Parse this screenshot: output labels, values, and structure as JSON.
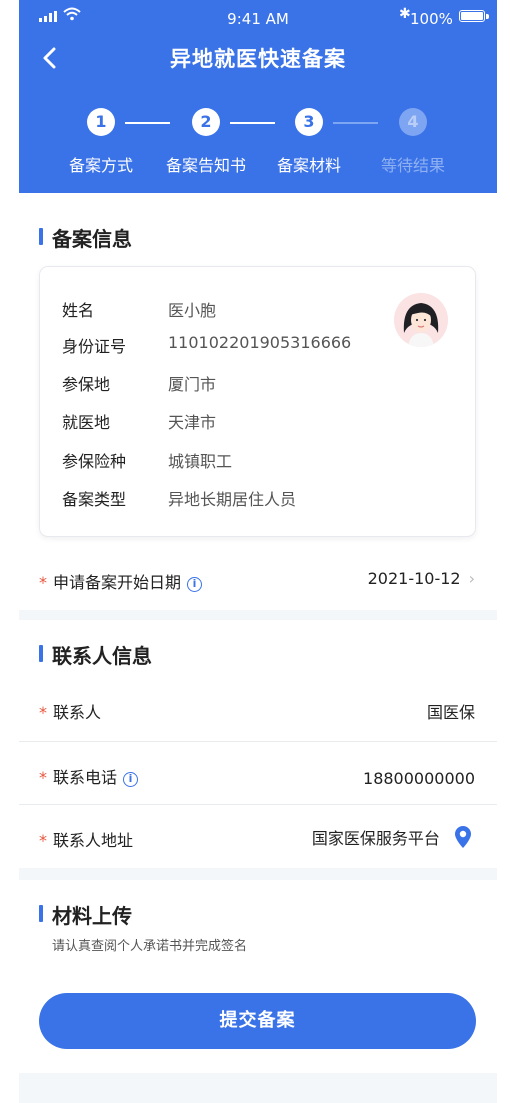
{
  "status_bar": {
    "time": "9:41 AM",
    "battery": "100%"
  },
  "nav": {
    "title": "异地就医快速备案"
  },
  "steps": [
    {
      "number": "1",
      "label": "备案方式",
      "state": "done"
    },
    {
      "number": "2",
      "label": "备案告知书",
      "state": "done"
    },
    {
      "number": "3",
      "label": "备案材料",
      "state": "current"
    },
    {
      "number": "4",
      "label": "等待结果",
      "state": "pending"
    }
  ],
  "filing_info": {
    "title": "备案信息",
    "rows": [
      {
        "key": "姓名",
        "value": "医小胞"
      },
      {
        "key": "身份证号",
        "value": "110102201905316666"
      },
      {
        "key": "参保地",
        "value": "厦门市"
      },
      {
        "key": "就医地",
        "value": "天津市"
      },
      {
        "key": "参保险种",
        "value": "城镇职工"
      },
      {
        "key": "备案类型",
        "value": "异地长期居住人员"
      }
    ],
    "start_date": {
      "label": "申请备案开始日期",
      "value": "2021-10-12"
    }
  },
  "contact_info": {
    "title": "联系人信息",
    "name": {
      "label": "联系人",
      "value": "国医保"
    },
    "phone": {
      "label": "联系电话",
      "value": "18800000000"
    },
    "address": {
      "label": "联系人地址",
      "value": "国家医保服务平台"
    }
  },
  "materials": {
    "title": "材料上传",
    "hint": "请认真查阅个人承诺书并完成签名",
    "submit_label": "提交备案"
  },
  "colors": {
    "primary": "#3a72e8",
    "required": "#e8553e",
    "background": "#f4f7fa"
  },
  "icons": [
    "signal-icon",
    "wifi-icon",
    "bluetooth-icon",
    "battery-icon",
    "back-icon",
    "avatar-icon",
    "info-icon",
    "chevron-right-icon",
    "location-pin-icon"
  ]
}
